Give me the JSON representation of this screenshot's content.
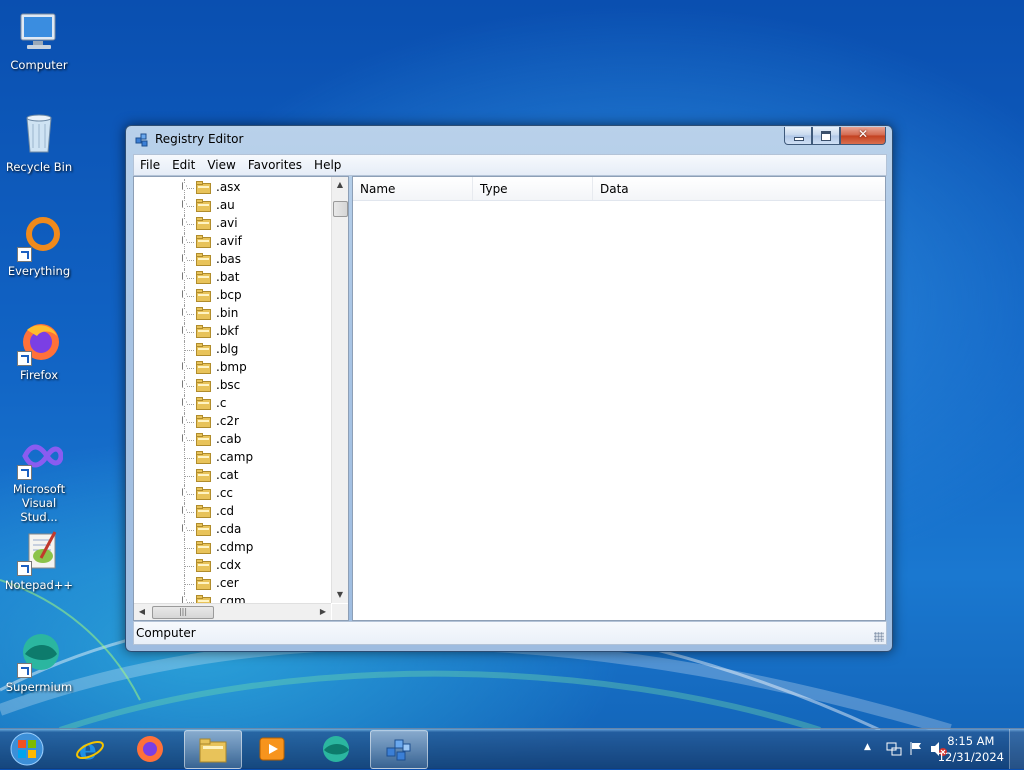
{
  "desktop": {
    "icons": [
      {
        "label": "Computer"
      },
      {
        "label": "Recycle Bin"
      },
      {
        "label": "Everything"
      },
      {
        "label": "Firefox"
      },
      {
        "label": "Microsoft Visual Stud..."
      },
      {
        "label": "Notepad++"
      },
      {
        "label": "Supermium"
      }
    ]
  },
  "window": {
    "title": "Registry Editor",
    "menu": [
      "File",
      "Edit",
      "View",
      "Favorites",
      "Help"
    ],
    "tree": {
      "items": [
        {
          "label": ".asx",
          "expandable": true
        },
        {
          "label": ".au",
          "expandable": true
        },
        {
          "label": ".avi",
          "expandable": true
        },
        {
          "label": ".avif",
          "expandable": true
        },
        {
          "label": ".bas",
          "expandable": true
        },
        {
          "label": ".bat",
          "expandable": true
        },
        {
          "label": ".bcp",
          "expandable": true
        },
        {
          "label": ".bin",
          "expandable": true
        },
        {
          "label": ".bkf",
          "expandable": true
        },
        {
          "label": ".blg",
          "expandable": false
        },
        {
          "label": ".bmp",
          "expandable": true
        },
        {
          "label": ".bsc",
          "expandable": true
        },
        {
          "label": ".c",
          "expandable": true
        },
        {
          "label": ".c2r",
          "expandable": true
        },
        {
          "label": ".cab",
          "expandable": true
        },
        {
          "label": ".camp",
          "expandable": false
        },
        {
          "label": ".cat",
          "expandable": false
        },
        {
          "label": ".cc",
          "expandable": true
        },
        {
          "label": ".cd",
          "expandable": true
        },
        {
          "label": ".cda",
          "expandable": true
        },
        {
          "label": ".cdmp",
          "expandable": false
        },
        {
          "label": ".cdx",
          "expandable": false
        },
        {
          "label": ".cer",
          "expandable": false
        },
        {
          "label": ".cgm",
          "expandable": true
        }
      ],
      "hscroll_thumb_glyph": "|||"
    },
    "columns": [
      "Name",
      "Type",
      "Data"
    ],
    "status": "Computer"
  },
  "taskbar": {
    "clock_time": "8:15 AM",
    "clock_date": "12/31/2024",
    "tray_overflow_glyph": "▲"
  },
  "colors": {
    "accent_folder": "#e8c35a",
    "selection": "#cde8ff"
  }
}
